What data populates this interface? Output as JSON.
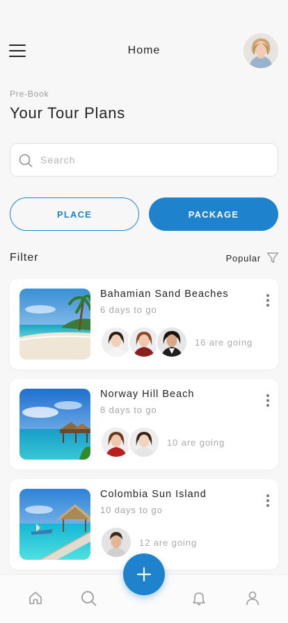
{
  "header": {
    "title": "Home"
  },
  "intro": {
    "eyebrow": "Pre-Book",
    "title": "Your Tour Plans"
  },
  "search": {
    "placeholder": "Search",
    "value": ""
  },
  "tabs": [
    {
      "label": "PLACE",
      "active": false
    },
    {
      "label": "PACKAGE",
      "active": true
    }
  ],
  "filter": {
    "label": "Filter",
    "sort_label": "Popular"
  },
  "tours": [
    {
      "name": "Bahamian Sand Beaches",
      "days": "6 days to go",
      "going": "16 are going",
      "avatars": 3
    },
    {
      "name": "Norway Hill Beach",
      "days": "8 days to go",
      "going": "10 are going",
      "avatars": 2
    },
    {
      "name": "Colombia Sun Island",
      "days": "10 days to go",
      "going": "12 are going",
      "avatars": 1
    }
  ],
  "colors": {
    "accent": "#1f82cc",
    "background": "#f7f7f8",
    "card": "#ffffff",
    "muted_text": "#a5a5a5"
  },
  "icons": {
    "menu": "hamburger-icon",
    "search": "search-icon",
    "filter": "filter-icon",
    "more": "more-vertical-icon",
    "add": "plus-icon",
    "nav": [
      "home-icon",
      "search-icon",
      "bell-icon",
      "user-icon"
    ]
  }
}
